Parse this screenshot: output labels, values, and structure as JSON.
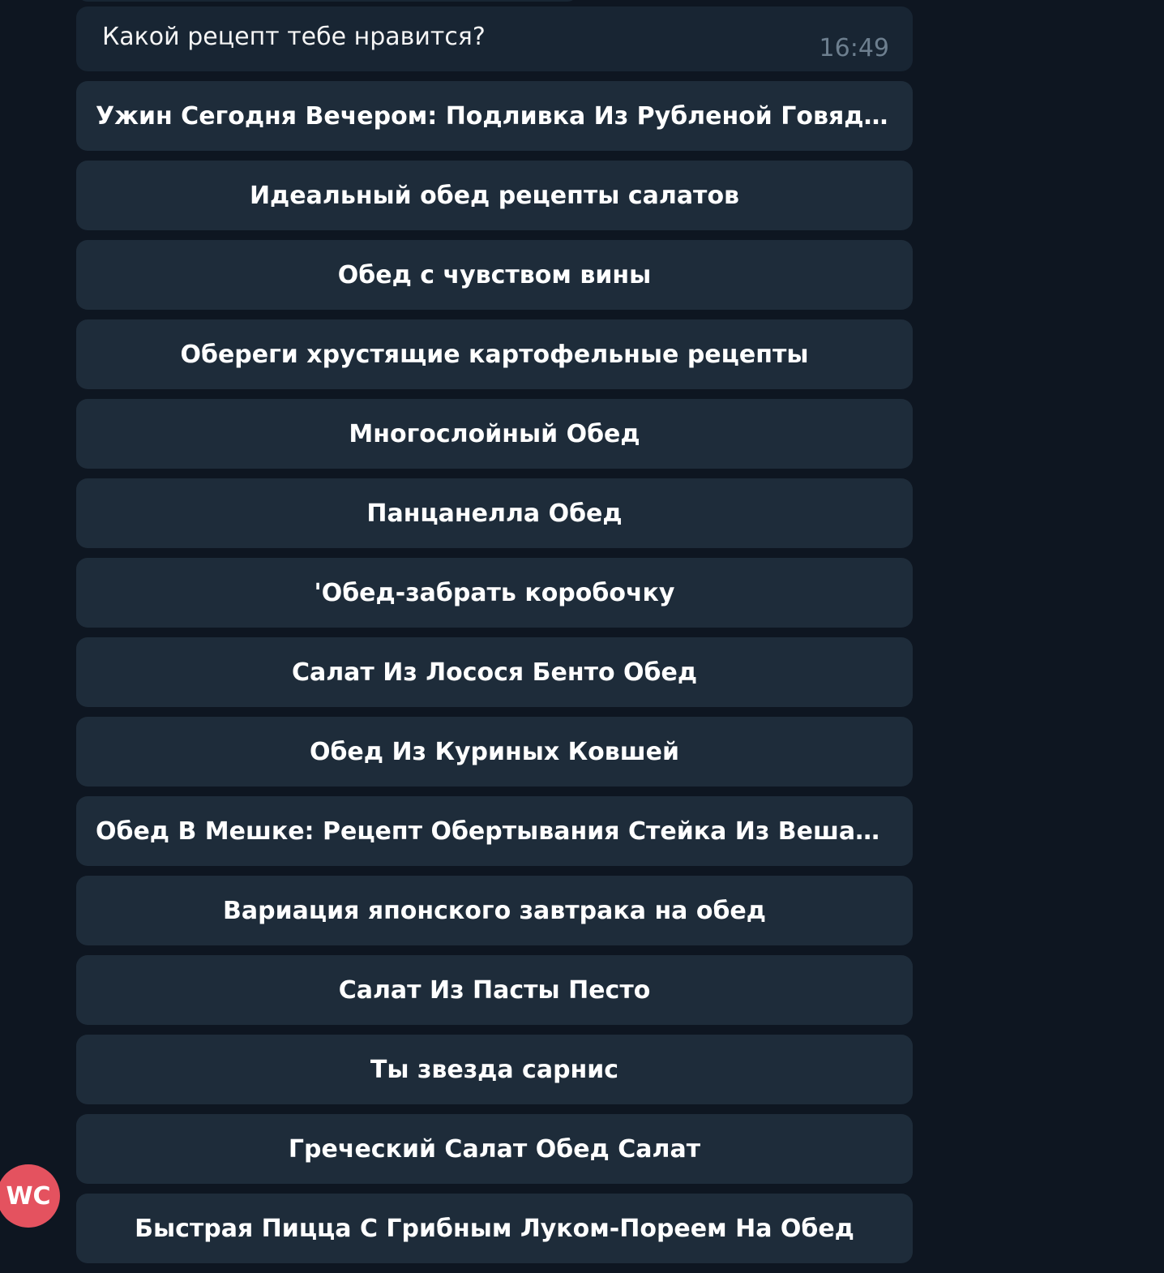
{
  "message": {
    "text": "Какой рецепт тебе нравится?",
    "time": "16:49"
  },
  "keyboard": {
    "buttons": [
      "Ужин Сегодня Вечером: Подливка Из Рубленой Говядины",
      "Идеальный обед рецепты салатов",
      "Обед с чувством вины",
      "Обереги хрустящие картофельные рецепты",
      "Многослойный Обед",
      "Панцанелла Обед",
      "'Обед-забрать коробочку",
      "Салат Из Лосося Бенто Обед",
      "Обед Из Куриных Ковшей",
      "Обед В Мешке: Рецепт Обертывания Стейка Из Вешалки С...",
      "Вариация японского завтрака на обед",
      "Салат Из Пасты Песто",
      "Ты звезда сарнис",
      "Греческий Салат Обед Салат",
      "Быстрая Пицца С Грибным Луком-Пореем На Обед"
    ]
  },
  "avatar": {
    "initials": "WC",
    "color": "#e4525f"
  },
  "colors": {
    "background": "#0e1621",
    "bubble": "#182533",
    "button": "#1e2c3a",
    "time": "#6d7f8f"
  }
}
